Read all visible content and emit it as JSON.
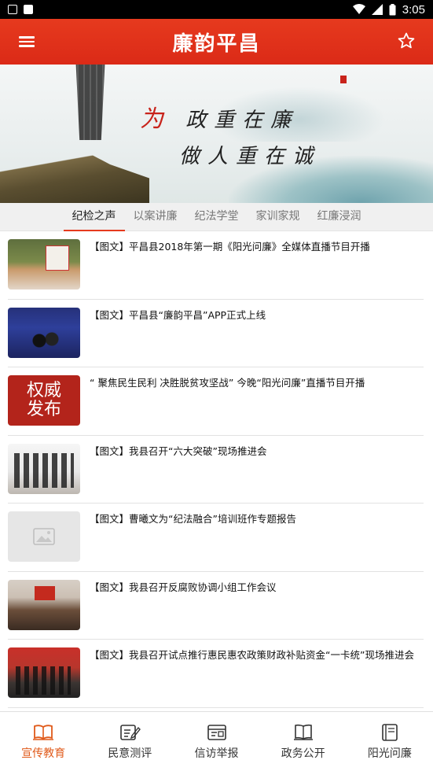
{
  "header": {
    "title": "廉韵平昌"
  },
  "status_bar": {
    "time": "3:05"
  },
  "banner": {
    "line1_red": "为",
    "line1": "政重在廉",
    "line2": "做人重在诚"
  },
  "tabs": [
    {
      "label": "纪检之声",
      "active": true
    },
    {
      "label": "以案讲廉",
      "active": false
    },
    {
      "label": "纪法学堂",
      "active": false
    },
    {
      "label": "家训家规",
      "active": false
    },
    {
      "label": "红廉浸润",
      "active": false
    }
  ],
  "news": [
    {
      "title": "【图文】平昌县2018年第一期《阳光问廉》全媒体直播节目开播"
    },
    {
      "title": "【图文】平昌县“廉韵平昌”APP正式上线"
    },
    {
      "title": "“ 聚焦民生民利 决胜脱贫攻坚战” 今晚“阳光问廉”直播节目开播",
      "thumb_text_1": "权威",
      "thumb_text_2": "发布"
    },
    {
      "title": "【图文】我县召开“六大突破”现场推进会"
    },
    {
      "title": "【图文】曹曦文为“纪法融合”培训班作专题报告"
    },
    {
      "title": "【图文】我县召开反腐败协调小组工作会议"
    },
    {
      "title": "【图文】我县召开试点推行惠民惠农政策财政补贴资金“一卡统”现场推进会"
    }
  ],
  "bottom_nav": [
    {
      "label": "宣传教育",
      "icon": "book-open-icon",
      "active": true
    },
    {
      "label": "民意测评",
      "icon": "edit-note-icon",
      "active": false
    },
    {
      "label": "信访举报",
      "icon": "mail-report-icon",
      "active": false
    },
    {
      "label": "政务公开",
      "icon": "open-book-icon",
      "active": false
    },
    {
      "label": "阳光问廉",
      "icon": "notebook-icon",
      "active": false
    }
  ],
  "colors": {
    "header": "#e63a1e",
    "accent": "#e05a1a",
    "tab_underline": "#e63a1e"
  }
}
